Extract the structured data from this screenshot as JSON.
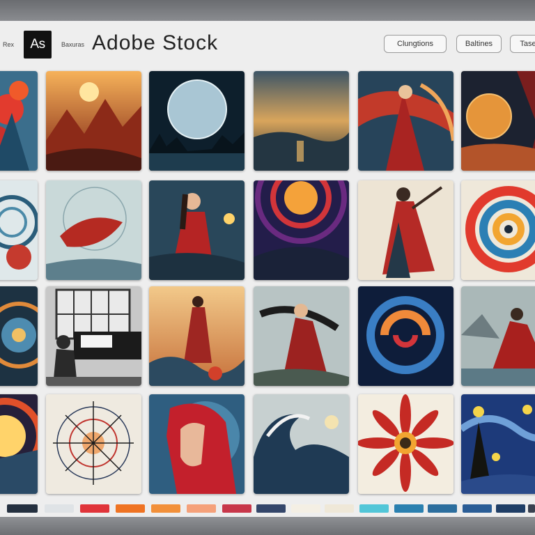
{
  "window": {
    "small_label_left": "Rex",
    "app_badge": "As",
    "small_label_mid": "Baxuras",
    "brand_title": "Adobe Stock"
  },
  "header_buttons": [
    {
      "label": "Clungtions"
    },
    {
      "label": "Baltines"
    },
    {
      "label": "Tase"
    }
  ],
  "grid": {
    "rows": 4,
    "columns": 6,
    "images": [
      "red-flowers-artwork",
      "fiery-mountain-landscape",
      "moon-over-water",
      "golden-sky-seascape",
      "woman-red-cloak-swirls",
      "planet-sunset-figure",
      "blue-dial-swirl",
      "red-creature-clock",
      "woman-red-dress-orb",
      "cosmic-red-vortex",
      "dancing-woman-red-robe",
      "colorful-swirl",
      "clockwork-circle",
      "man-at-piano",
      "figure-in-storm",
      "woman-windblown-hair",
      "blue-orange-spiral",
      "figure-on-shore",
      "sun-burst-abstract",
      "compass-mandala",
      "red-haired-woman-profile",
      "great-wave-moon",
      "red-sunflower",
      "starry-night-tree"
    ]
  },
  "palette": [
    "#24303f",
    "#dfe3e6",
    "#e0343a",
    "#ef7323",
    "#f2903a",
    "#f5a17a",
    "#c8374a",
    "#34466a",
    "#f4efe4",
    "#efe8d8",
    "#52c6d8",
    "#2a80b0",
    "#2c6e9e",
    "#2a5d96",
    "#1f3e66",
    "#3a4150"
  ]
}
